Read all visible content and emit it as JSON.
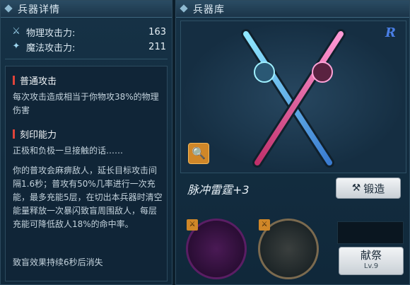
{
  "detail_panel": {
    "title": "兵器详情",
    "stats": [
      {
        "label": "物理攻击力:",
        "value": "163",
        "icon": "sword-icon"
      },
      {
        "label": "魔法攻击力:",
        "value": "211",
        "icon": "wand-icon"
      }
    ],
    "normal_attack": {
      "title": "普通攻击",
      "text": "每次攻击造成相当于你物攻38%的物理伤害"
    },
    "imprint": {
      "title": "刻印能力",
      "intro": "正极和负极一旦接触的话……",
      "body": "你的普攻会麻痹敌人，延长目标攻击间隔1.6秒；普攻有50%几率进行一次充能，最多充能5层，在切出本兵器时清空能量释放一次暴闪致盲周围敌人，每层充能可降低敌人18%的命中率。",
      "footer": "致盲效果持续6秒后消失"
    }
  },
  "armory_panel": {
    "title": "兵器库",
    "rank": "R",
    "weapon_name": "脉冲雷霆+3",
    "forge_button": "锻造",
    "offer_button": "献祭",
    "offer_level": "Lv.9"
  },
  "colors": {
    "accent_red": "#e0443a",
    "rank_blue": "#4a7fe6",
    "badge_orange": "#d08728"
  }
}
